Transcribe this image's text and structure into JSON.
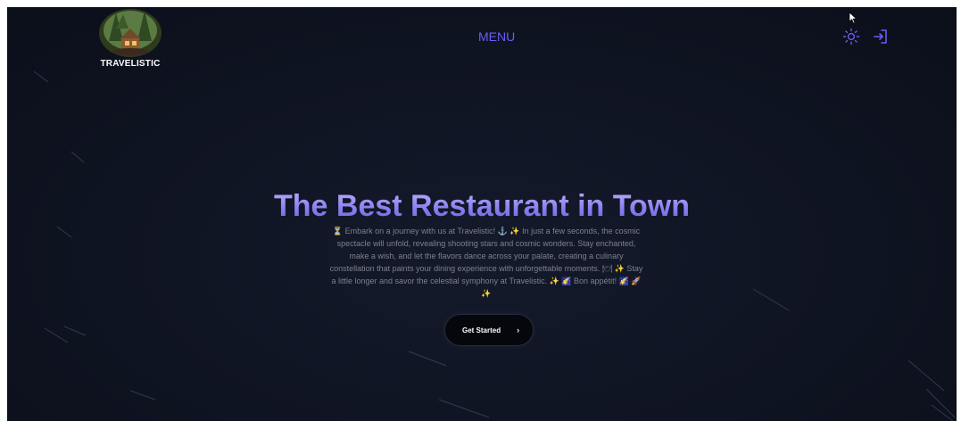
{
  "brand": {
    "name": "TRAVELISTIC"
  },
  "nav": {
    "menu_label": "MENU"
  },
  "icons": {
    "theme": "sun-icon",
    "login": "login-icon",
    "cursor": "mouse-cursor-icon"
  },
  "hero": {
    "title": "The Best Restaurant in Town",
    "description": "⏳ Embark on a journey with us at Travelistic! ⚓ ✨ In just a few seconds, the cosmic spectacle will unfold, revealing shooting stars and cosmic wonders. Stay enchanted, make a wish, and let the flavors dance across your palate, creating a culinary constellation that paints your dining experience with unforgettable moments. 🍽 ✨ Stay a little longer and savor the celestial symphony at Travelistic. ✨ 🌠 Bon appétit! 🌠 🚀 ✨",
    "cta_label": "Get Started",
    "cta_arrow": "›"
  },
  "colors": {
    "background": "#0f1422",
    "accent": "#6b5cf6",
    "title_gradient_top": "#b9b2ff",
    "title_gradient_bottom": "#6b60e0",
    "text_muted": "#7d818d"
  }
}
